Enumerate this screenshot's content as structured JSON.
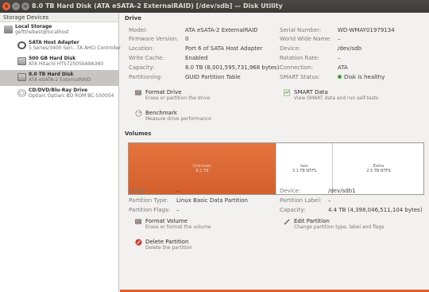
{
  "window": {
    "title": "8.0 TB Hard Disk (ATA eSATA-2 ExternalRAID) [/dev/sdb] — Disk Utility",
    "close_glyph": "×",
    "min_glyph": "–",
    "max_glyph": "+"
  },
  "sidebar": {
    "header": "Storage Devices",
    "items": [
      {
        "name": "Local Storage",
        "sub": "geftthebest@localhost"
      },
      {
        "name": "SATA Host Adapter",
        "sub": "5 Series/3400 Seri...TA AHCI Controller"
      },
      {
        "name": "500 GB Hard Disk",
        "sub": "ATA Hitachi HTS725050A9A360"
      },
      {
        "name": "8.0 TB Hard Disk",
        "sub": "ATA eSATA-2 ExternalRAID"
      },
      {
        "name": "CD/DVD/Blu-Ray Drive",
        "sub": "Optiarc Optiarc BD ROM BC-5500S4"
      }
    ]
  },
  "drive": {
    "title": "Drive",
    "left_fields": [
      {
        "label": "Model:",
        "value": "ATA eSATA-2 ExternalRAID"
      },
      {
        "label": "Firmware Version:",
        "value": "0"
      },
      {
        "label": "Location:",
        "value": "Port 6 of SATA Host Adapter"
      },
      {
        "label": "Write Cache:",
        "value": "Enabled"
      },
      {
        "label": "Capacity:",
        "value": "8.0 TB (8,001,595,731,968 bytes)"
      },
      {
        "label": "Partitioning:",
        "value": "GUID Partition Table"
      }
    ],
    "right_fields": [
      {
        "label": "Serial Number:",
        "value": "WD-WMAY01979134"
      },
      {
        "label": "World Wide Name:",
        "value": "–"
      },
      {
        "label": "Device:",
        "value": "/dev/sdb"
      },
      {
        "label": "Rotation Rate:",
        "value": "–"
      },
      {
        "label": "Connection:",
        "value": "ATA"
      },
      {
        "label": "SMART Status:",
        "value": "Disk is healthy"
      }
    ],
    "actions": {
      "format": {
        "title": "Format Drive",
        "desc": "Erase or partition the drive"
      },
      "smart": {
        "title": "SMART Data",
        "desc": "View SMART data and run self-tests"
      },
      "benchmark": {
        "title": "Benchmark",
        "desc": "Measure drive performance"
      }
    }
  },
  "volumes": {
    "title": "Volumes",
    "bar": [
      {
        "line1": "Unknown",
        "line2": "8.2 TB"
      },
      {
        "line1": "Isos",
        "line2": "3.1 TB NTFS"
      },
      {
        "line1": "Extra",
        "line2": "2.5 TB NTFS"
      }
    ],
    "left_fields": [
      {
        "label": "Usage:",
        "value": "–"
      },
      {
        "label": "Partition Type:",
        "value": "Linux Basic Data Partition"
      },
      {
        "label": "Partition Flags:",
        "value": "–"
      }
    ],
    "right_fields": [
      {
        "label": "Device:",
        "value": "/dev/sdb1"
      },
      {
        "label": "Partition Label:",
        "value": "–"
      },
      {
        "label": "Capacity:",
        "value": "4.4 TB (4,398,046,511,104 bytes)"
      }
    ],
    "actions": {
      "format": {
        "title": "Format Volume",
        "desc": "Erase or format the volume"
      },
      "edit": {
        "title": "Edit Partition",
        "desc": "Change partition type, label and flags"
      },
      "delete": {
        "title": "Delete Partition",
        "desc": "Delete the partition"
      }
    }
  },
  "colors": {
    "accent": "#d9642f",
    "healthy": "#4a9a3a"
  }
}
